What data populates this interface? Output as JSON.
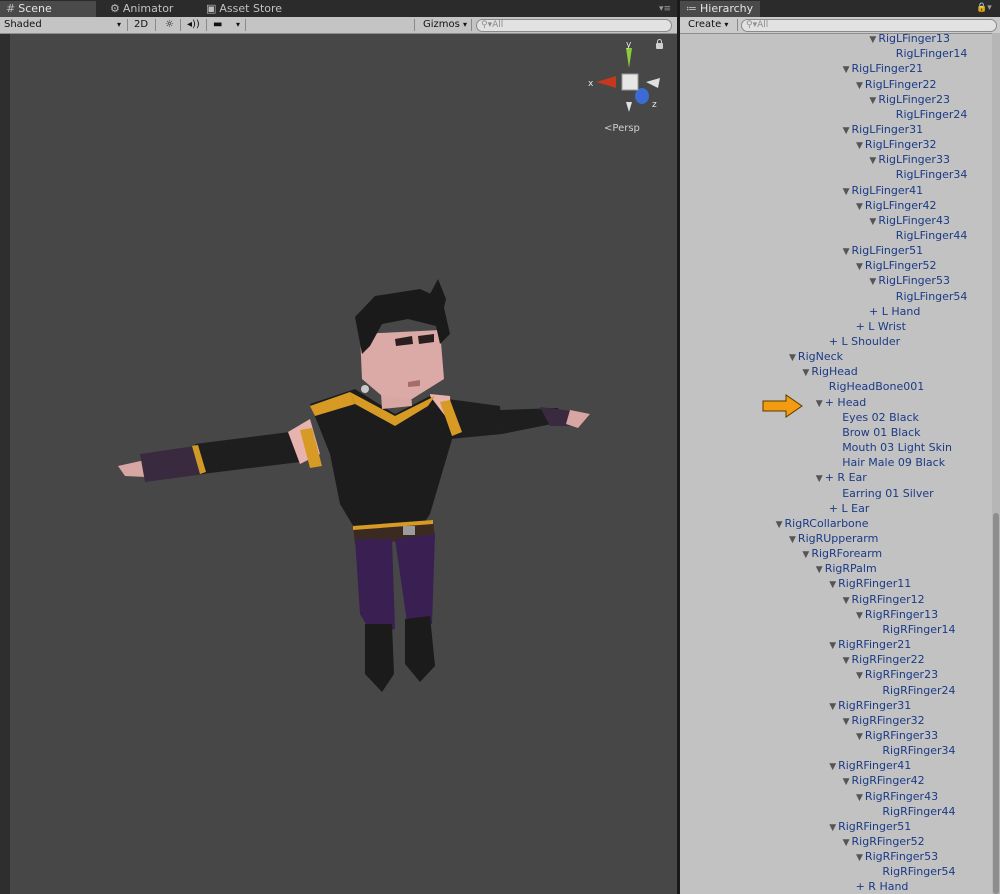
{
  "scene": {
    "tabs": [
      {
        "label": "Scene",
        "icon": "grid-icon"
      },
      {
        "label": "Animator",
        "icon": "animator-icon"
      },
      {
        "label": "Asset Store",
        "icon": "store-icon"
      }
    ],
    "toolbar": {
      "shading_mode": "Shaded",
      "mode_2d": "2D",
      "gizmos_label": "Gizmos",
      "search_placeholder": "All"
    },
    "view": {
      "projection_label": "Persp",
      "axes": {
        "x": "x",
        "y": "y",
        "z": "z"
      }
    }
  },
  "hierarchy": {
    "tab_label": "Hierarchy",
    "create_label": "Create",
    "search_placeholder": "All",
    "rows": [
      {
        "label": "RigLFinger13",
        "depth": 6,
        "expanded": true
      },
      {
        "label": "RigLFinger14",
        "depth": 7,
        "expanded": null
      },
      {
        "label": "RigLFinger21",
        "depth": 4,
        "expanded": true
      },
      {
        "label": "RigLFinger22",
        "depth": 5,
        "expanded": true
      },
      {
        "label": "RigLFinger23",
        "depth": 6,
        "expanded": true
      },
      {
        "label": "RigLFinger24",
        "depth": 7,
        "expanded": null
      },
      {
        "label": "RigLFinger31",
        "depth": 4,
        "expanded": true
      },
      {
        "label": "RigLFinger32",
        "depth": 5,
        "expanded": true
      },
      {
        "label": "RigLFinger33",
        "depth": 6,
        "expanded": true
      },
      {
        "label": "RigLFinger34",
        "depth": 7,
        "expanded": null
      },
      {
        "label": "RigLFinger41",
        "depth": 4,
        "expanded": true
      },
      {
        "label": "RigLFinger42",
        "depth": 5,
        "expanded": true
      },
      {
        "label": "RigLFinger43",
        "depth": 6,
        "expanded": true
      },
      {
        "label": "RigLFinger44",
        "depth": 7,
        "expanded": null
      },
      {
        "label": "RigLFinger51",
        "depth": 4,
        "expanded": true
      },
      {
        "label": "RigLFinger52",
        "depth": 5,
        "expanded": true
      },
      {
        "label": "RigLFinger53",
        "depth": 6,
        "expanded": true
      },
      {
        "label": "RigLFinger54",
        "depth": 7,
        "expanded": null
      },
      {
        "label": "+ L Hand",
        "depth": 5,
        "expanded": null
      },
      {
        "label": "+ L Wrist",
        "depth": 4,
        "expanded": null
      },
      {
        "label": "+ L Shoulder",
        "depth": 2,
        "expanded": null
      },
      {
        "label": "RigNeck",
        "depth": 0,
        "expanded": true
      },
      {
        "label": "RigHead",
        "depth": 1,
        "expanded": true
      },
      {
        "label": "RigHeadBone001",
        "depth": 2,
        "expanded": null
      },
      {
        "label": "+ Head",
        "depth": 2,
        "expanded": true
      },
      {
        "label": "Eyes 02 Black",
        "depth": 3,
        "expanded": null
      },
      {
        "label": "Brow 01 Black",
        "depth": 3,
        "expanded": null
      },
      {
        "label": "Mouth 03 Light Skin",
        "depth": 3,
        "expanded": null
      },
      {
        "label": "Hair Male 09 Black",
        "depth": 3,
        "expanded": null
      },
      {
        "label": "+ R Ear",
        "depth": 2,
        "expanded": true
      },
      {
        "label": "Earring 01 Silver",
        "depth": 3,
        "expanded": null
      },
      {
        "label": "+ L Ear",
        "depth": 2,
        "expanded": null
      },
      {
        "label": "RigRCollarbone",
        "depth": -1,
        "expanded": true
      },
      {
        "label": "RigRUpperarm",
        "depth": 0,
        "expanded": true
      },
      {
        "label": "RigRForearm",
        "depth": 1,
        "expanded": true
      },
      {
        "label": "RigRPalm",
        "depth": 2,
        "expanded": true
      },
      {
        "label": "RigRFinger11",
        "depth": 3,
        "expanded": true
      },
      {
        "label": "RigRFinger12",
        "depth": 4,
        "expanded": true
      },
      {
        "label": "RigRFinger13",
        "depth": 5,
        "expanded": true
      },
      {
        "label": "RigRFinger14",
        "depth": 6,
        "expanded": null
      },
      {
        "label": "RigRFinger21",
        "depth": 3,
        "expanded": true
      },
      {
        "label": "RigRFinger22",
        "depth": 4,
        "expanded": true
      },
      {
        "label": "RigRFinger23",
        "depth": 5,
        "expanded": true
      },
      {
        "label": "RigRFinger24",
        "depth": 6,
        "expanded": null
      },
      {
        "label": "RigRFinger31",
        "depth": 3,
        "expanded": true
      },
      {
        "label": "RigRFinger32",
        "depth": 4,
        "expanded": true
      },
      {
        "label": "RigRFinger33",
        "depth": 5,
        "expanded": true
      },
      {
        "label": "RigRFinger34",
        "depth": 6,
        "expanded": null
      },
      {
        "label": "RigRFinger41",
        "depth": 3,
        "expanded": true
      },
      {
        "label": "RigRFinger42",
        "depth": 4,
        "expanded": true
      },
      {
        "label": "RigRFinger43",
        "depth": 5,
        "expanded": true
      },
      {
        "label": "RigRFinger44",
        "depth": 6,
        "expanded": null
      },
      {
        "label": "RigRFinger51",
        "depth": 3,
        "expanded": true
      },
      {
        "label": "RigRFinger52",
        "depth": 4,
        "expanded": true
      },
      {
        "label": "RigRFinger53",
        "depth": 5,
        "expanded": true
      },
      {
        "label": "RigRFinger54",
        "depth": 6,
        "expanded": null
      },
      {
        "label": "+ R Hand",
        "depth": 4,
        "expanded": null
      }
    ]
  },
  "colors": {
    "hierarchy_text": "#1b3a86",
    "callout_arrow": "#f39c12",
    "viewport_bg": "#474747"
  }
}
